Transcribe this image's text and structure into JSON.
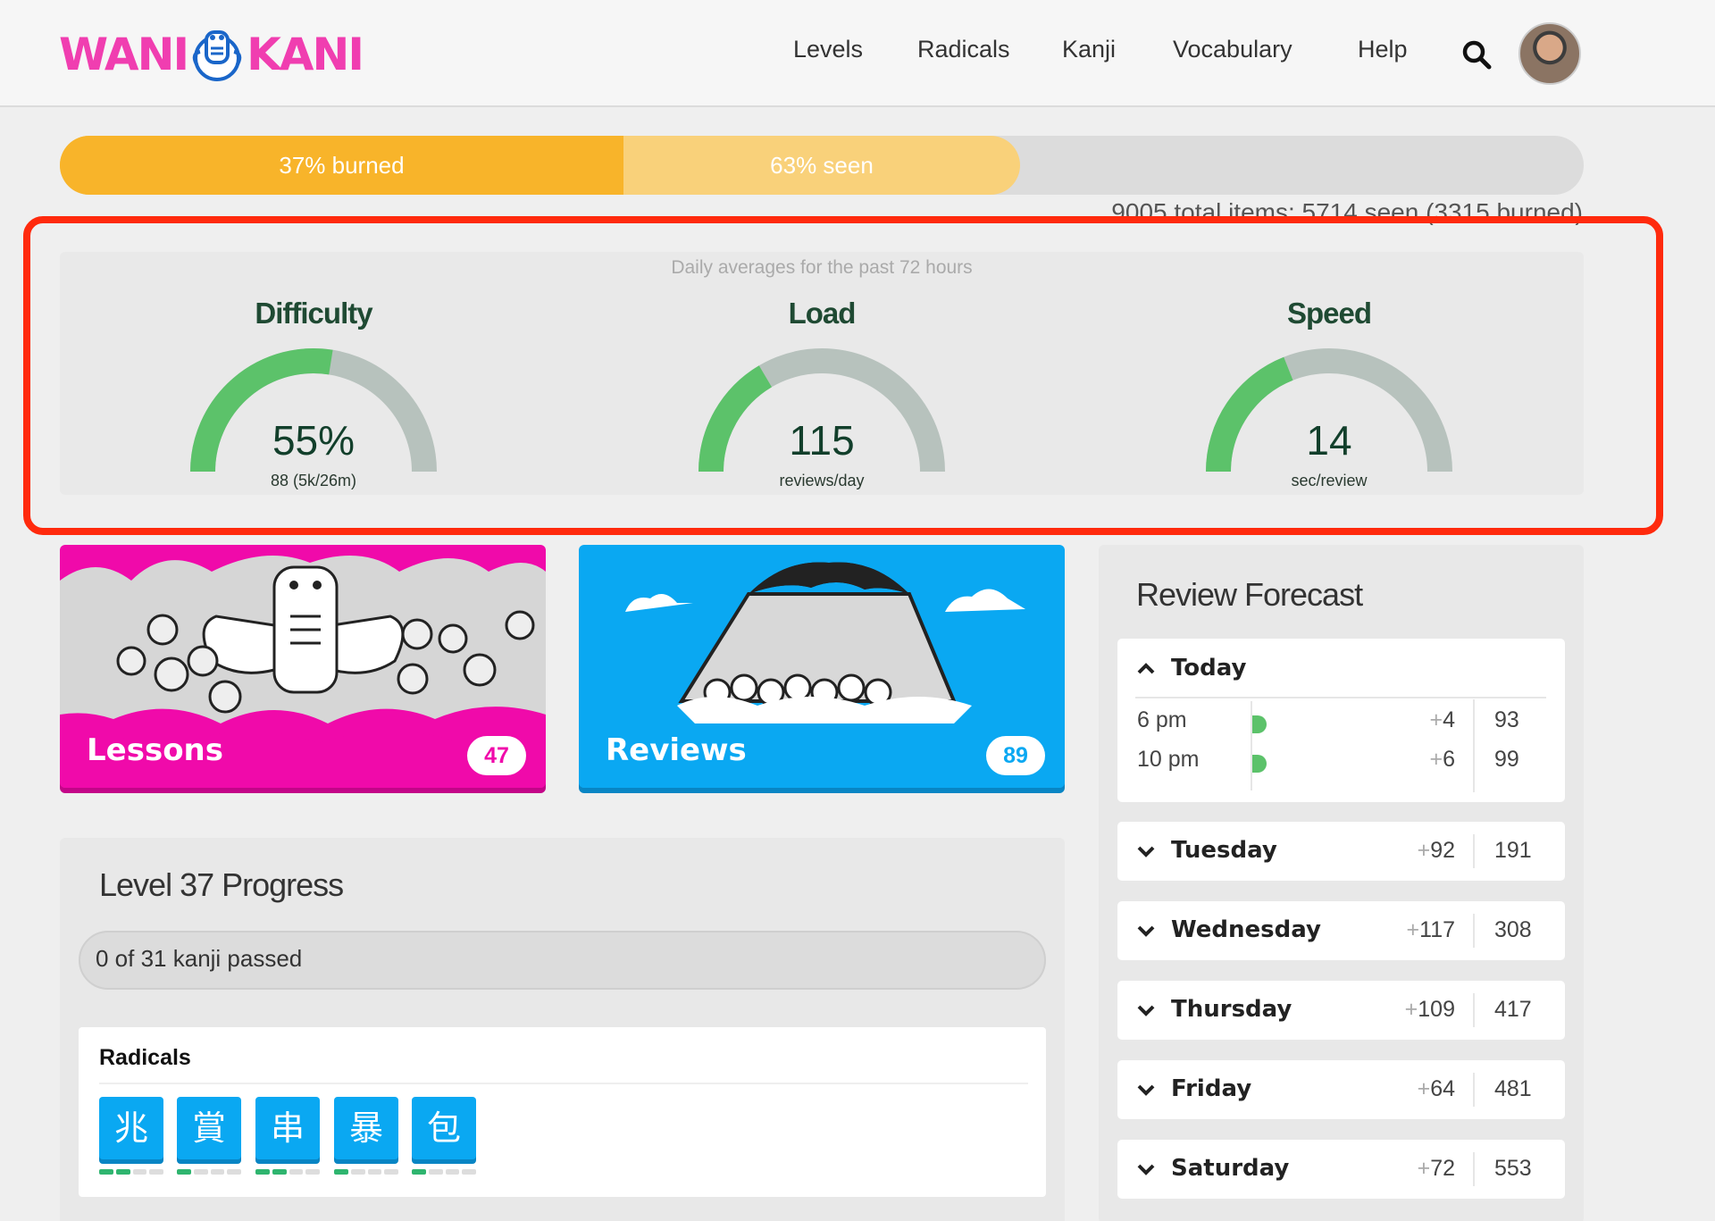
{
  "header": {
    "logo_left": "WANI",
    "logo_right": "KANI",
    "nav": [
      "Levels",
      "Radicals",
      "Kanji",
      "Vocabulary",
      "Help"
    ],
    "search_icon": "search-icon",
    "avatar_icon": "user-avatar"
  },
  "progress": {
    "burned_label": "37% burned",
    "burned_pct": 37,
    "seen_label": "63% seen",
    "seen_pct": 63,
    "totals": "9005 total items: 5714 seen (3315 burned)"
  },
  "averages": {
    "caption": "Daily averages for the past 72 hours",
    "gauges": [
      {
        "title": "Difficulty",
        "value": "55%",
        "sub": "88 (5k/26m)",
        "fill": 0.55
      },
      {
        "title": "Load",
        "value": "115",
        "sub": "reviews/day",
        "fill": 0.33
      },
      {
        "title": "Speed",
        "value": "14",
        "sub": "sec/review",
        "fill": 0.38
      }
    ],
    "colors": {
      "fill": "#5cc26a",
      "track": "#b7c2bd"
    }
  },
  "cards": {
    "lessons": {
      "label": "Lessons",
      "count": "47"
    },
    "reviews": {
      "label": "Reviews",
      "count": "89"
    }
  },
  "level": {
    "title": "Level 37 Progress",
    "kanji_bar": "0 of 31 kanji passed",
    "radicals_heading": "Radicals",
    "radicals": [
      {
        "char": "兆",
        "progress": 2
      },
      {
        "char": "賞",
        "progress": 1
      },
      {
        "char": "串",
        "progress": 2
      },
      {
        "char": "暴",
        "progress": 1
      },
      {
        "char": "包",
        "progress": 1
      }
    ]
  },
  "forecast": {
    "title": "Review Forecast",
    "today": {
      "name": "Today",
      "rows": [
        {
          "time": "6 pm",
          "plus": "4",
          "total": "93"
        },
        {
          "time": "10 pm",
          "plus": "6",
          "total": "99"
        }
      ]
    },
    "days": [
      {
        "name": "Tuesday",
        "plus": "92",
        "total": "191"
      },
      {
        "name": "Wednesday",
        "plus": "117",
        "total": "308"
      },
      {
        "name": "Thursday",
        "plus": "109",
        "total": "417"
      },
      {
        "name": "Friday",
        "plus": "64",
        "total": "481"
      },
      {
        "name": "Saturday",
        "plus": "72",
        "total": "553"
      }
    ],
    "plus_sign": "+"
  }
}
